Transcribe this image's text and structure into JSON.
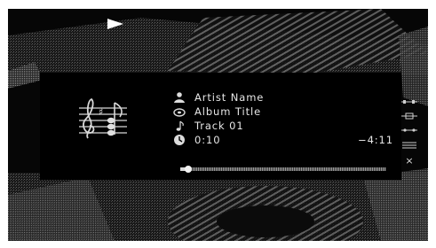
{
  "track": {
    "artist": "Artist Name",
    "album": "Album Title",
    "title": "Track 01",
    "elapsed": "0:10",
    "remaining": "−4:11",
    "progress_fraction": 0.04
  },
  "icons": {
    "play_indicator": "play-icon",
    "artist": "artist-icon",
    "album": "album-icon",
    "track": "music-note-icon",
    "time": "clock-icon",
    "album_art": "sheet-music-icon",
    "side_controls": [
      "repeat-icon",
      "shuffle-icon",
      "equalizer-icon",
      "list-icon",
      "close-icon"
    ]
  },
  "side_controls": {
    "close_label": "×"
  },
  "colors": {
    "background": "#050505",
    "panel": "#000000",
    "text": "#e6e6e6"
  }
}
